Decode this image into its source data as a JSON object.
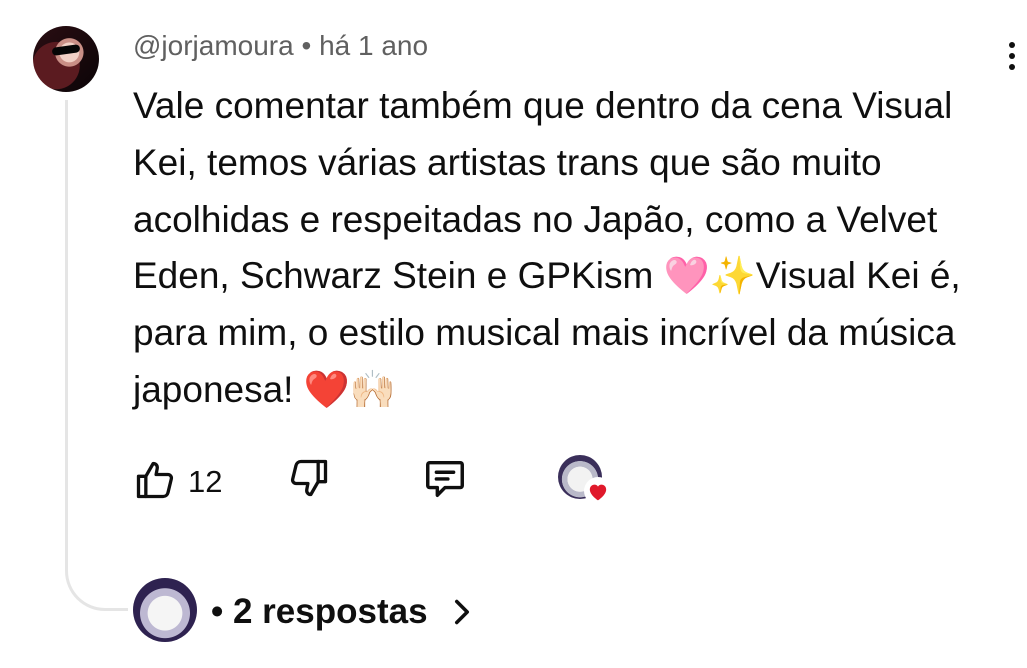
{
  "comment": {
    "author": "@jorjamoura",
    "separator": "•",
    "time": "há 1 ano",
    "lines": [
      "Vale comentar também que dentro da cena Visual",
      "Kei, temos várias artistas trans que são muito",
      "acolhidas e respeitadas no Japão, como a Velvet",
      "Eden, Schwarz Stein e GPKism 🩷✨Visual Kei é,",
      "para mim, o estilo musical mais incrível da música",
      "japonesa! ❤️🙌🏻"
    ]
  },
  "actions": {
    "like_count": "12",
    "icons": [
      "thumbs-up-icon",
      "thumbs-down-icon",
      "reply-icon",
      "creator-heart-icon"
    ]
  },
  "replies": {
    "label": "• 2 respostas",
    "icon": "chevron-right-icon"
  },
  "colors": {
    "text": "#0f0f0f",
    "meta": "#606060",
    "thread": "#e5e5e5",
    "heart": "#e0192b"
  }
}
